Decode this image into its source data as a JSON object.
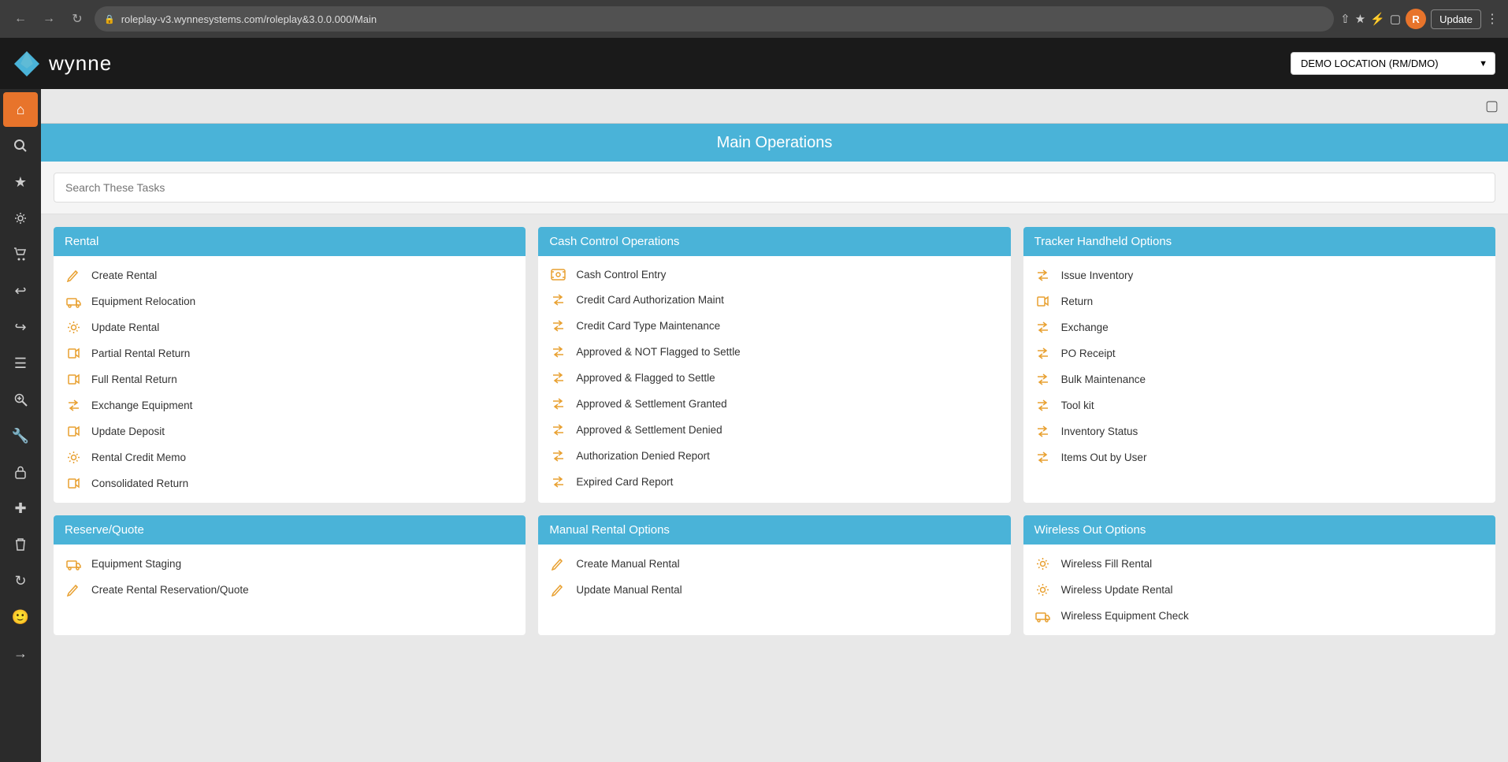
{
  "browser": {
    "url": "roleplay-v3.wynnesystems.com/roleplay&3.0.0.000/Main",
    "update_label": "Update",
    "user_initial": "R"
  },
  "app": {
    "logo_text": "wynne",
    "location_select": "DEMO LOCATION (RM/DMO)",
    "page_title": "Main Operations",
    "search_placeholder": "Search These Tasks"
  },
  "sidebar": {
    "items": [
      {
        "name": "home",
        "icon": "⌂",
        "active": true
      },
      {
        "name": "search",
        "icon": "🔍",
        "active": false
      },
      {
        "name": "star",
        "icon": "★",
        "active": false
      },
      {
        "name": "settings",
        "icon": "⚙",
        "active": false
      },
      {
        "name": "cart",
        "icon": "🛒",
        "active": false
      },
      {
        "name": "undo",
        "icon": "↩",
        "active": false
      },
      {
        "name": "redo",
        "icon": "↪",
        "active": false
      },
      {
        "name": "list",
        "icon": "≡",
        "active": false
      },
      {
        "name": "search-view",
        "icon": "🔎",
        "active": false
      },
      {
        "name": "wrench",
        "icon": "🔧",
        "active": false
      },
      {
        "name": "lock",
        "icon": "🔒",
        "active": false
      },
      {
        "name": "plus",
        "icon": "✚",
        "active": false
      },
      {
        "name": "trash",
        "icon": "🗑",
        "active": false
      },
      {
        "name": "refresh",
        "icon": "↻",
        "active": false
      },
      {
        "name": "faces",
        "icon": "😊",
        "active": false
      },
      {
        "name": "logout",
        "icon": "→",
        "active": false
      }
    ]
  },
  "sections": [
    {
      "id": "rental",
      "title": "Rental",
      "items": [
        {
          "icon": "pencil",
          "label": "Create Rental"
        },
        {
          "icon": "truck",
          "label": "Equipment Relocation"
        },
        {
          "icon": "gear",
          "label": "Update Rental"
        },
        {
          "icon": "partial-return",
          "label": "Partial Rental Return"
        },
        {
          "icon": "full-return",
          "label": "Full Rental Return"
        },
        {
          "icon": "exchange",
          "label": "Exchange Equipment"
        },
        {
          "icon": "deposit",
          "label": "Update Deposit"
        },
        {
          "icon": "gear",
          "label": "Rental Credit Memo"
        },
        {
          "icon": "partial-return",
          "label": "Consolidated Return"
        }
      ]
    },
    {
      "id": "cash-control",
      "title": "Cash Control Operations",
      "items": [
        {
          "icon": "cash",
          "label": "Cash Control Entry"
        },
        {
          "icon": "exchange",
          "label": "Credit Card Authorization Maint"
        },
        {
          "icon": "exchange",
          "label": "Credit Card Type Maintenance"
        },
        {
          "icon": "exchange",
          "label": "Approved & NOT Flagged to Settle"
        },
        {
          "icon": "exchange",
          "label": "Approved & Flagged to Settle"
        },
        {
          "icon": "exchange",
          "label": "Approved & Settlement Granted"
        },
        {
          "icon": "exchange",
          "label": "Approved & Settlement Denied"
        },
        {
          "icon": "exchange",
          "label": "Authorization Denied Report"
        },
        {
          "icon": "exchange",
          "label": "Expired Card Report"
        }
      ]
    },
    {
      "id": "tracker",
      "title": "Tracker Handheld Options",
      "items": [
        {
          "icon": "exchange",
          "label": "Issue Inventory"
        },
        {
          "icon": "partial-return",
          "label": "Return"
        },
        {
          "icon": "exchange",
          "label": "Exchange"
        },
        {
          "icon": "exchange",
          "label": "PO Receipt"
        },
        {
          "icon": "exchange",
          "label": "Bulk Maintenance"
        },
        {
          "icon": "exchange",
          "label": "Tool kit"
        },
        {
          "icon": "exchange",
          "label": "Inventory Status"
        },
        {
          "icon": "exchange",
          "label": "Items Out by User"
        }
      ]
    },
    {
      "id": "reserve-quote",
      "title": "Reserve/Quote",
      "items": [
        {
          "icon": "truck",
          "label": "Equipment Staging"
        },
        {
          "icon": "pencil",
          "label": "Create Rental Reservation/Quote"
        }
      ]
    },
    {
      "id": "manual-rental",
      "title": "Manual Rental Options",
      "items": [
        {
          "icon": "pencil",
          "label": "Create Manual Rental"
        },
        {
          "icon": "pencil",
          "label": "Update Manual Rental"
        }
      ]
    },
    {
      "id": "wireless-out",
      "title": "Wireless Out Options",
      "items": [
        {
          "icon": "gear",
          "label": "Wireless Fill Rental"
        },
        {
          "icon": "gear",
          "label": "Wireless Update Rental"
        },
        {
          "icon": "truck",
          "label": "Wireless Equipment Check"
        }
      ]
    }
  ]
}
